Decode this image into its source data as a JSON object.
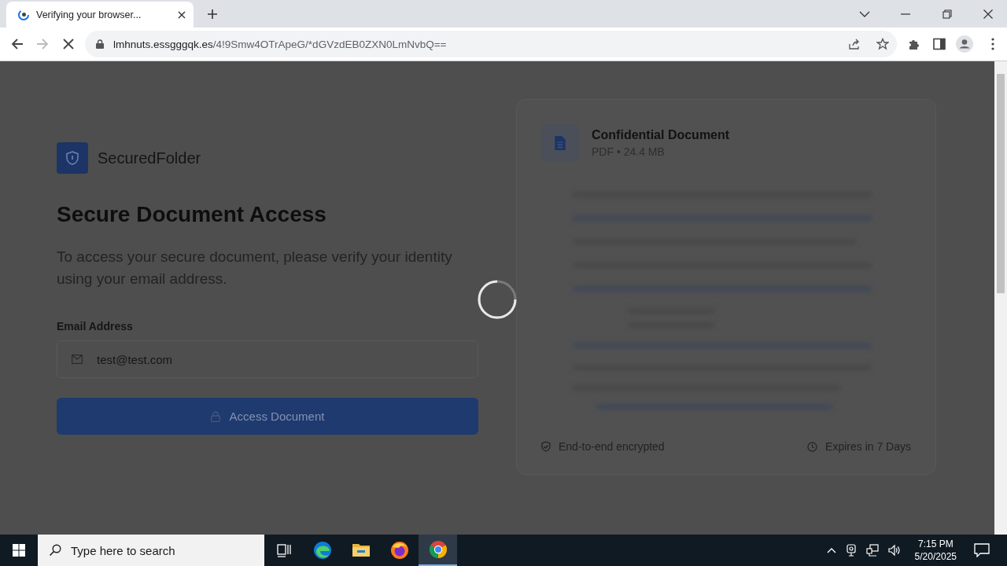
{
  "browser": {
    "tab": {
      "title": "Verifying your browser...",
      "selected": true
    },
    "url": {
      "host": "lmhnuts.essgggqk.es",
      "path": "/4!9Smw4OTrApeG/*dGVzdEB0ZXN0LmNvbQ=="
    },
    "loading": true
  },
  "page": {
    "brand": "SecuredFolder",
    "heading": "Secure Document Access",
    "description": "To access your secure document, please verify your identity using your email address.",
    "email_label": "Email Address",
    "email_value": "test@test.com",
    "button": "Access Document",
    "busy": true
  },
  "document": {
    "title": "Confidential Document",
    "meta": "PDF • 24.4 MB",
    "features": [
      {
        "kind": "encrypted",
        "label": "End-to-end encrypted"
      },
      {
        "kind": "expiry",
        "label": "Expires in 7 Days"
      }
    ]
  },
  "taskbar": {
    "search_placeholder": "Type here to search",
    "time": "7:15 PM",
    "date": "5/20/2025",
    "apps": [
      {
        "kind": "taskview",
        "selected": false
      },
      {
        "kind": "edge",
        "selected": false
      },
      {
        "kind": "explorer",
        "selected": false
      },
      {
        "kind": "firefox",
        "selected": false
      },
      {
        "kind": "chrome",
        "selected": true
      }
    ]
  }
}
